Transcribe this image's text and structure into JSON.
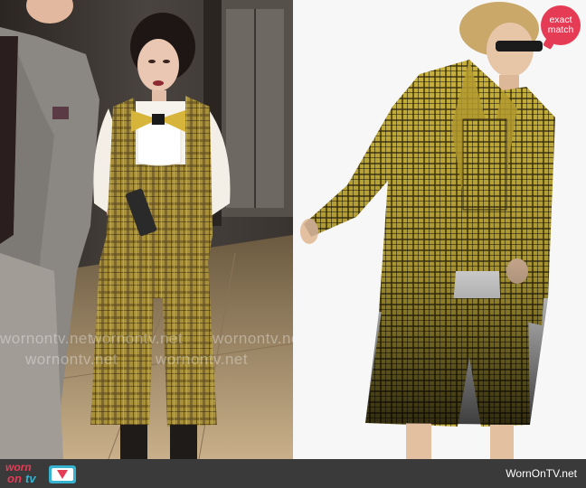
{
  "left_photo": {
    "description_icon": "tv-still-image",
    "watermarks": [
      "wornontv.net",
      "wornontv.net",
      "wornontv.net",
      "wornontv.net",
      "wornontv.net"
    ]
  },
  "right_photo": {
    "description_icon": "runway-product-image"
  },
  "badge": {
    "line1": "exact",
    "line2": "match"
  },
  "footer": {
    "logo_worn": "worn",
    "logo_on": "on",
    "logo_tv": "tv",
    "url": "WornOnTV.net"
  },
  "colors": {
    "badge": "#e63b55",
    "footer_bg": "#3a3a3a",
    "logo_accent": "#37b3cf",
    "plaid": "#b8a23a"
  }
}
